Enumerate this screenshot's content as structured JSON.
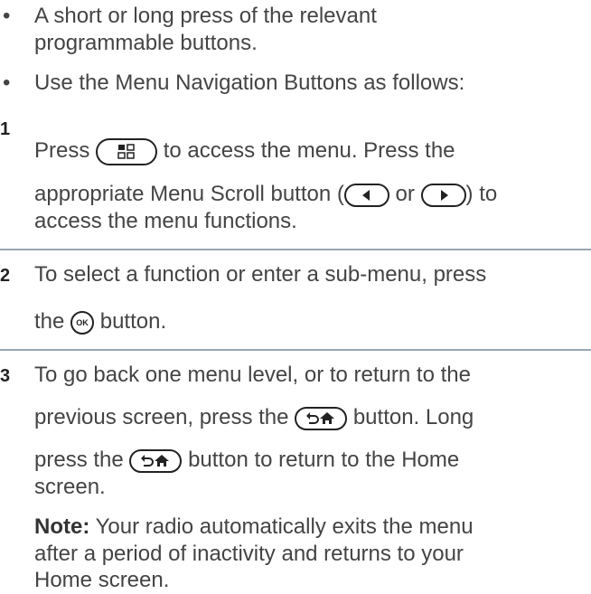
{
  "bullets": [
    {
      "marker": "•",
      "lines": [
        "A short or long press of the relevant",
        "programmable buttons."
      ]
    },
    {
      "marker": "•",
      "lines": [
        "Use the Menu Navigation Buttons as follows:"
      ]
    }
  ],
  "steps": [
    {
      "number": "1",
      "line1_a": "Press",
      "line1_b": "to access the menu. Press the",
      "line2_a": "appropriate Menu Scroll button (",
      "line2_or": "or",
      "line2_b": ") to",
      "line3": "access the menu functions."
    },
    {
      "number": "2",
      "line1": "To select a function or enter a sub-menu, press",
      "line2_a": "the",
      "line2_b": "button."
    },
    {
      "number": "3",
      "line1": "To go back one menu level, or to return to the",
      "line2_a": "previous screen, press the",
      "line2_b": "button. Long",
      "line3_a": "press the",
      "line3_b": "button to return to the Home",
      "line4": "screen."
    }
  ],
  "note": {
    "label": "Note:",
    "line1": "Your radio automatically exits the menu",
    "line2": "after a period of inactivity and returns to your",
    "line3": "Home screen."
  },
  "icons": {
    "menu": "menu-button-icon",
    "left": "left-scroll-button-icon",
    "right": "right-scroll-button-icon",
    "ok": "ok-button-icon",
    "ok_text": "OK",
    "back_home": "back-home-button-icon"
  }
}
